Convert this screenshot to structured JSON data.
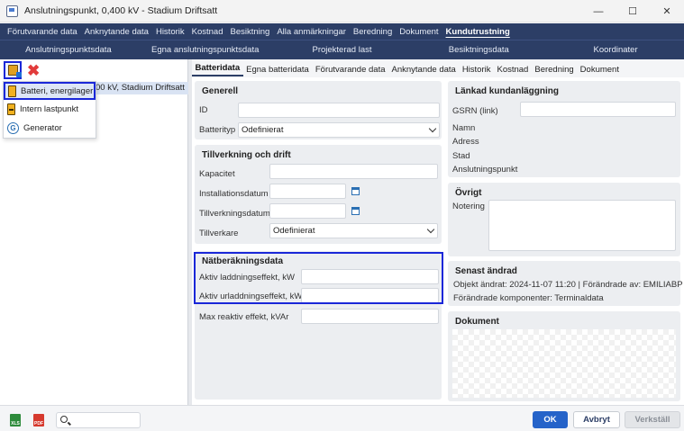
{
  "window": {
    "title": "Anslutningspunkt, 0,400 kV - Stadium Driftsatt",
    "controls": [
      "—",
      "☐",
      "✕"
    ]
  },
  "menu": [
    "Förutvarande data",
    "Anknytande data",
    "Historik",
    "Kostnad",
    "Besiktning",
    "Alla anmärkningar",
    "Beredning",
    "Dokument",
    "Kundutrustning"
  ],
  "submenu": [
    "Anslutningspunktsdata",
    "Egna anslutningspunktsdata",
    "Projekterad last",
    "Besiktningsdata",
    "Koordinater"
  ],
  "tree": {
    "item_label": "00 kV, Stadium Driftsatt"
  },
  "add_menu": [
    {
      "label": "Batteri, energilager",
      "icon": "battery-icon"
    },
    {
      "label": "Intern lastpunkt",
      "icon": "load-point-icon"
    },
    {
      "label": "Generator",
      "icon": "generator-icon"
    }
  ],
  "tabs": [
    "Batteridata",
    "Egna batteridata",
    "Förutvarande data",
    "Anknytande data",
    "Historik",
    "Kostnad",
    "Beredning",
    "Dokument"
  ],
  "generell": {
    "title": "Generell",
    "id_label": "ID",
    "id_value": "",
    "batterityp_label": "Batterityp",
    "batterityp_value": "Odefinierat"
  },
  "tillverkning": {
    "title": "Tillverkning och drift",
    "kapacitet_label": "Kapacitet",
    "kapacitet_value": "",
    "installationsdatum_label": "Installationsdatum",
    "installationsdatum_value": "",
    "tillverkningsdatum_label": "Tillverkningsdatum",
    "tillverkningsdatum_value": "",
    "tillverkare_label": "Tillverkare",
    "tillverkare_value": "Odefinierat"
  },
  "natberakning": {
    "title": "Nätberäkningsdata",
    "laddning_label": "Aktiv laddningseffekt, kW",
    "laddning_value": "",
    "urladdning_label": "Aktiv urladdningseffekt, kW",
    "urladdning_value": "",
    "reaktiv_label": "Max reaktiv effekt, kVAr",
    "reaktiv_value": ""
  },
  "lankad": {
    "title": "Länkad kundanläggning",
    "gsrn_label": "GSRN (link)",
    "gsrn_value": "",
    "namn_label": "Namn",
    "adress_label": "Adress",
    "stad_label": "Stad",
    "anslutningspunkt_label": "Anslutningspunkt"
  },
  "ovrigt": {
    "title": "Övrigt",
    "notering_label": "Notering",
    "notering_value": ""
  },
  "senast": {
    "title": "Senast ändrad",
    "line1": "Objekt ändrat: 2024-11-07 11:20 | Förändrade av: EMILIABP",
    "line2": "Förändrade komponenter: Terminaldata"
  },
  "dokument": {
    "title": "Dokument"
  },
  "footer": {
    "xls_label": "XLS",
    "pdf_label": "PDF",
    "search_value": "",
    "ok_label": "OK",
    "cancel_label": "Avbryt",
    "apply_label": "Verkställ"
  }
}
